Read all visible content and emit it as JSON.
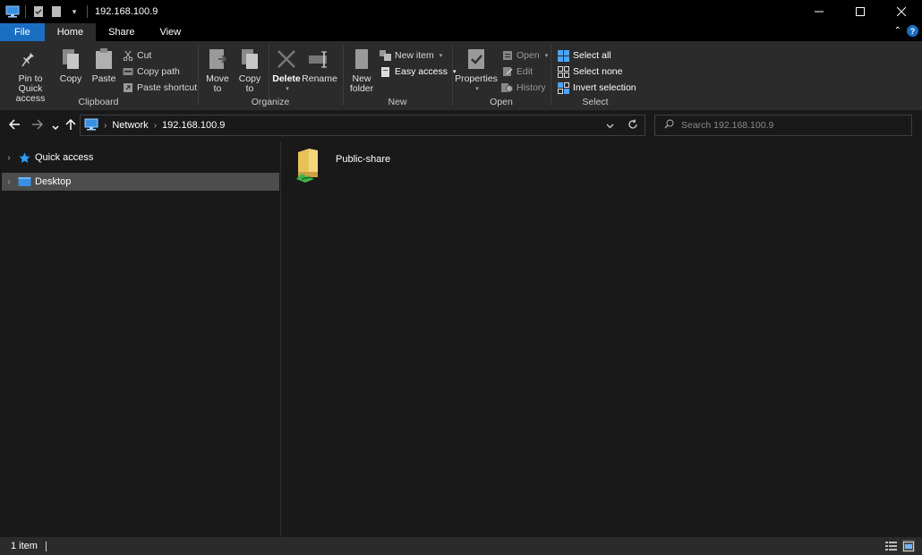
{
  "window": {
    "title": "192.168.100.9",
    "controls": {
      "minimize": "—",
      "maximize": "☐",
      "close": "✕"
    }
  },
  "ribbon_tabs": [
    "File",
    "Home",
    "Share",
    "View"
  ],
  "ribbon": {
    "clipboard": {
      "label": "Clipboard",
      "pin_line1": "Pin to Quick",
      "pin_line2": "access",
      "copy": "Copy",
      "paste": "Paste",
      "cut": "Cut",
      "copy_path": "Copy path",
      "paste_shortcut": "Paste shortcut"
    },
    "organize": {
      "label": "Organize",
      "move_line1": "Move",
      "move_line2": "to",
      "copyto_line1": "Copy",
      "copyto_line2": "to",
      "delete": "Delete",
      "rename": "Rename"
    },
    "new": {
      "label": "New",
      "folder_line1": "New",
      "folder_line2": "folder",
      "new_item": "New item",
      "easy_access": "Easy access"
    },
    "open": {
      "label": "Open",
      "properties": "Properties",
      "open": "Open",
      "edit": "Edit",
      "history": "History"
    },
    "select": {
      "label": "Select",
      "select_all": "Select all",
      "select_none": "Select none",
      "invert": "Invert selection"
    }
  },
  "address": {
    "crumbs": [
      "Network",
      "192.168.100.9"
    ],
    "search_placeholder": "Search 192.168.100.9"
  },
  "nav_tree": [
    {
      "label": "Quick access",
      "icon": "star-icon"
    },
    {
      "label": "Desktop",
      "icon": "desktop-folder-icon",
      "selected": true
    }
  ],
  "items": [
    {
      "label": "Public-share",
      "icon": "shared-folder-icon"
    }
  ],
  "status": {
    "count": "1 item"
  },
  "colors": {
    "accent": "#1a6ec2",
    "background": "#191919",
    "ribbon": "#2b2b2b",
    "selected": "#4d4d4d"
  }
}
